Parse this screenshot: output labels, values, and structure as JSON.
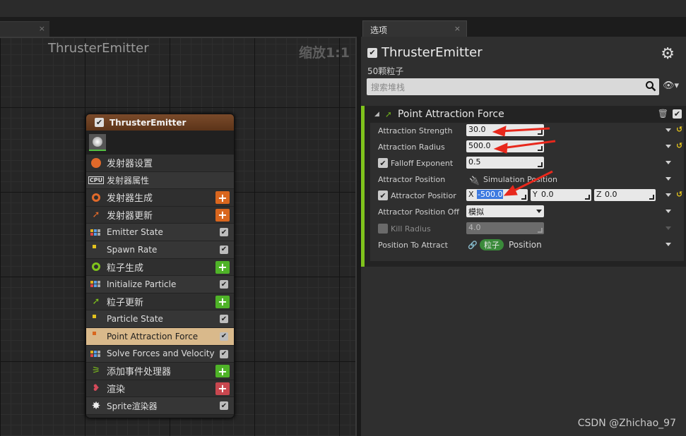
{
  "tabs": {
    "options_tab": "选项",
    "close_glyph": "×"
  },
  "graph": {
    "title": "ThrusterEmitter",
    "zoom": "缩放1:1"
  },
  "node": {
    "title": "ThrusterEmitter",
    "rows": [
      {
        "label": "发射器设置",
        "kind": "section",
        "icon": "emitter-settings-icon",
        "color": "#e0692a"
      },
      {
        "label": "发射器属性",
        "kind": "sub",
        "icon": "cpu-icon",
        "color": "#dddddd",
        "icon_text": "CPU"
      },
      {
        "label": "发射器生成",
        "kind": "section",
        "icon": "emitter-spawn-icon",
        "color": "#e0692a",
        "plus": "orange"
      },
      {
        "label": "发射器更新",
        "kind": "section",
        "icon": "emitter-update-icon",
        "color": "#e0692a",
        "plus": "orange"
      },
      {
        "label": "Emitter State",
        "kind": "sub",
        "icon": "module-dots-icon",
        "check": true
      },
      {
        "label": "Spawn Rate",
        "kind": "sub",
        "icon": "module-dot-icon",
        "check": true
      },
      {
        "label": "粒子生成",
        "kind": "section",
        "icon": "particle-spawn-icon",
        "color": "#7fc31c",
        "plus": "green"
      },
      {
        "label": "Initialize Particle",
        "kind": "sub",
        "icon": "module-dots-icon",
        "check": true
      },
      {
        "label": "粒子更新",
        "kind": "section",
        "icon": "particle-update-icon",
        "color": "#7fc31c",
        "plus": "green"
      },
      {
        "label": "Particle State",
        "kind": "sub",
        "icon": "module-dot-icon",
        "check": true
      },
      {
        "label": "Point Attraction Force",
        "kind": "sel",
        "icon": "module-dot-icon",
        "check": true
      },
      {
        "label": "Solve Forces and Velocity",
        "kind": "sub",
        "icon": "module-dots-icon",
        "check": true
      },
      {
        "label": "添加事件处理器",
        "kind": "section",
        "icon": "event-handler-icon",
        "color": "#7fc31c",
        "plus": "green"
      },
      {
        "label": "渲染",
        "kind": "section",
        "icon": "render-icon",
        "color": "#d44a5a",
        "plus": "red"
      },
      {
        "label": "Sprite渲染器",
        "kind": "sub",
        "icon": "sprite-icon",
        "check": true
      }
    ]
  },
  "panel": {
    "title": "ThrusterEmitter",
    "subtitle": "50颗粒子",
    "search_placeholder": "搜索堆栈",
    "module": {
      "title": "Point Attraction Force",
      "properties": {
        "attraction_strength": {
          "label": "Attraction Strength",
          "value": "30.0"
        },
        "attraction_radius": {
          "label": "Attraction Radius",
          "value": "500.0"
        },
        "falloff_exponent": {
          "label": "Falloff Exponent",
          "value": "0.5"
        },
        "attractor_position_mode": {
          "label": "Attractor Position",
          "value": "Simulation Position"
        },
        "attractor_position": {
          "label": "Attractor Positior",
          "x_label": "X",
          "x": "-500.0",
          "y_label": "Y",
          "y": "0.0",
          "z_label": "Z",
          "z": "0.0"
        },
        "attractor_position_offset": {
          "label": "Attractor Position Off",
          "value": "模拟"
        },
        "kill_radius": {
          "label": "Kill Radius",
          "value": "4.0"
        },
        "position_to_attract": {
          "label": "Position To Attract",
          "chip": "粒子",
          "value": "Position"
        }
      }
    }
  },
  "watermark": "CSDN @Zhichao_97",
  "colors": {
    "accent_green": "#7fc31c",
    "node_header": "#6b3f22",
    "selected_row": "#d9b98b",
    "annotation_red": "#e8281c"
  }
}
